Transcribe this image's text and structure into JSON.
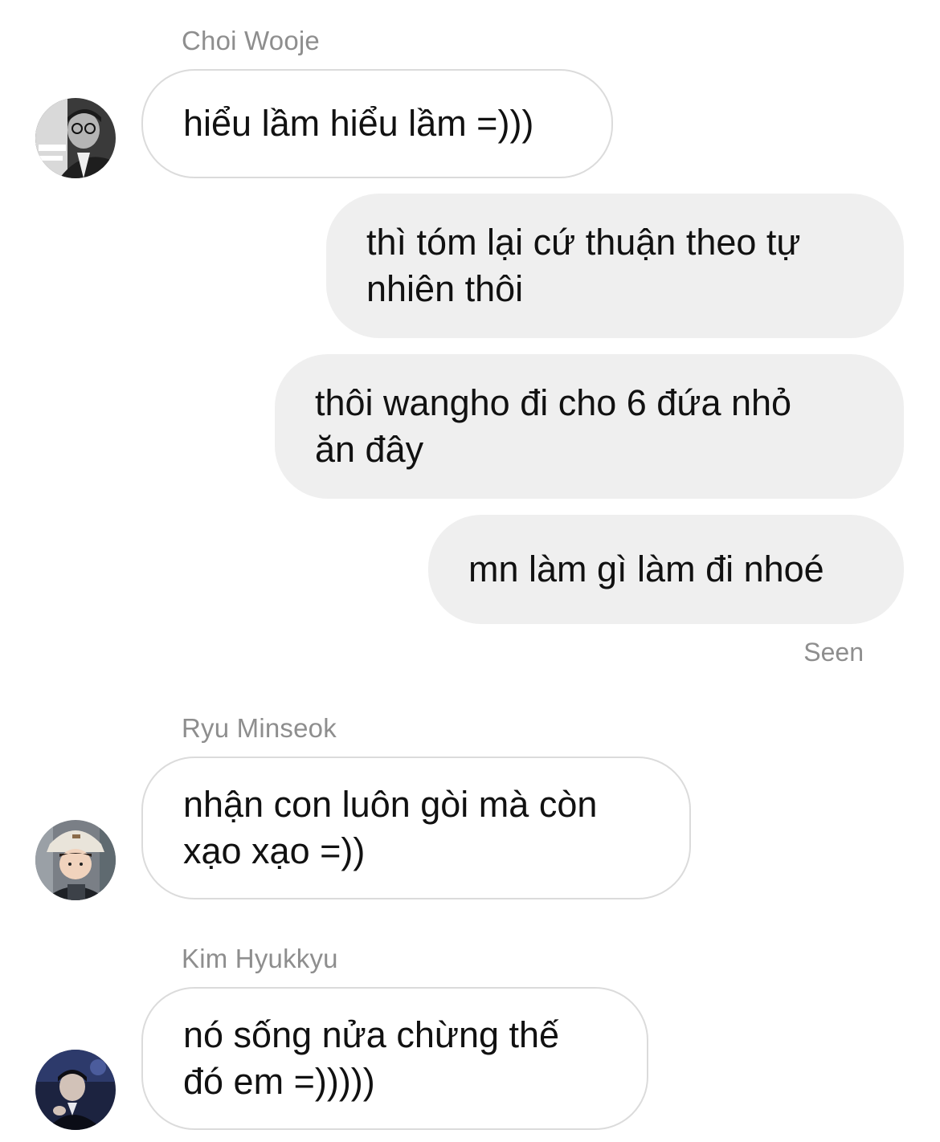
{
  "messages": [
    {
      "sender": "Choi Wooje",
      "avatar_icon": "user-avatar-choi-wooje",
      "line1": "hiểu lầm hiểu lầm =)))",
      "line2": ""
    },
    {
      "sender": "me",
      "line1": "thì tóm lại cứ thuận theo tự",
      "line2": "nhiên thôi"
    },
    {
      "sender": "me",
      "line1": "thôi wangho đi cho 6 đứa nhỏ",
      "line2": "ăn đây"
    },
    {
      "sender": "me",
      "line1": "mn làm gì làm đi nhoé",
      "line2": ""
    },
    {
      "sender": "Ryu Minseok",
      "avatar_icon": "user-avatar-ryu-minseok",
      "line1": "nhận con luôn gòi mà còn",
      "line2": "xạo xạo =))"
    },
    {
      "sender": "Kim Hyukkyu",
      "avatar_icon": "user-avatar-kim-hyukkyu",
      "line1": "nó sống nửa chừng thế",
      "line2": "đó em =)))))"
    }
  ],
  "status": {
    "seen_label": "Seen"
  },
  "colors": {
    "incoming_border": "#dbdbdb",
    "outgoing_bg": "#efefef",
    "meta_text": "#8e8e8e"
  }
}
